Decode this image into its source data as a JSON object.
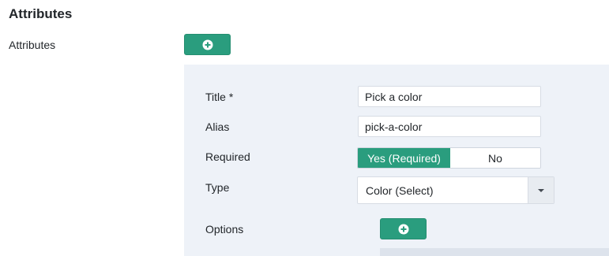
{
  "section": {
    "heading": "Attributes"
  },
  "attributes_field": {
    "label": "Attributes"
  },
  "form": {
    "title": {
      "label": "Title *",
      "value": "Pick a color"
    },
    "alias": {
      "label": "Alias",
      "value": "pick-a-color"
    },
    "required": {
      "label": "Required",
      "yes_label": "Yes (Required)",
      "no_label": "No",
      "selected": "yes"
    },
    "type": {
      "label": "Type",
      "value": "Color (Select)"
    },
    "options": {
      "label": "Options"
    }
  },
  "icons": {
    "add": "plus-circle-icon",
    "dropdown": "caret-down-icon"
  },
  "colors": {
    "accent": "#2a9d7e",
    "panel_bg": "#eef2f8"
  }
}
